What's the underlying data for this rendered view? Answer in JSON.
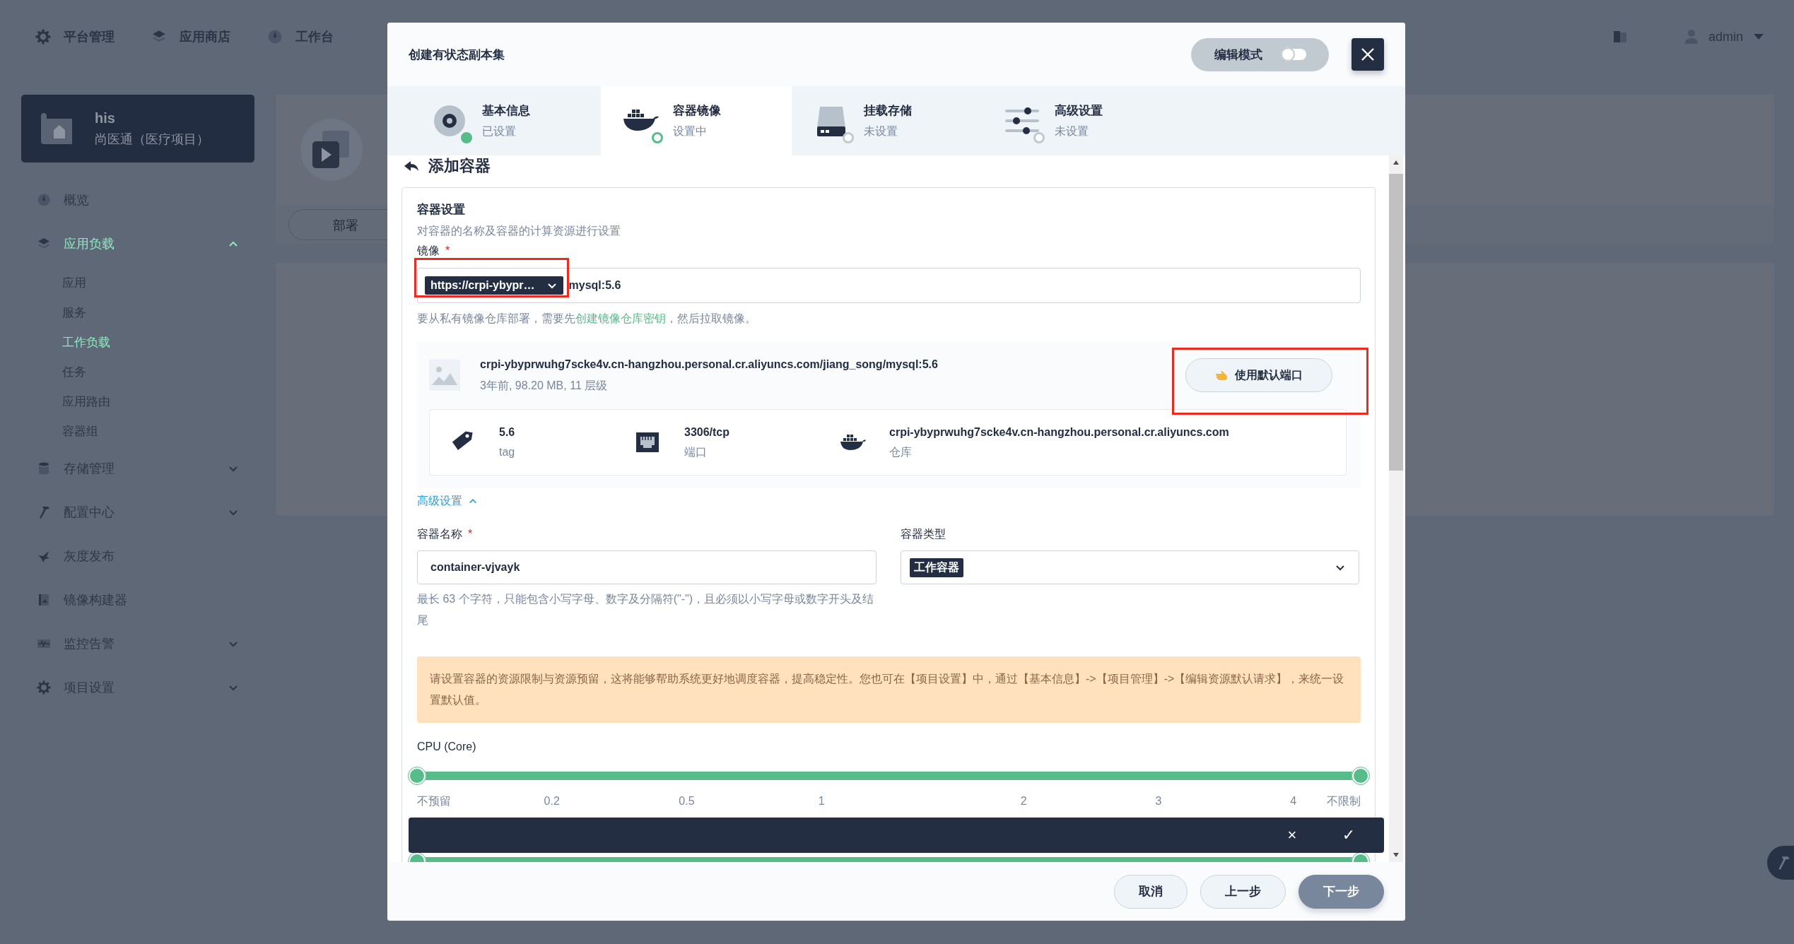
{
  "top_nav": {
    "items": [
      {
        "label": "平台管理"
      },
      {
        "label": "应用商店"
      },
      {
        "label": "工作台"
      }
    ],
    "user": "admin"
  },
  "sidebar": {
    "project": {
      "name": "his",
      "description": "尚医通（医疗项目）"
    },
    "items": [
      {
        "label": "概览",
        "selected": false
      },
      {
        "label": "应用负载",
        "selected": true,
        "expanded": true,
        "children": [
          {
            "label": "应用",
            "selected": false
          },
          {
            "label": "服务",
            "selected": false
          },
          {
            "label": "工作负载",
            "selected": true
          },
          {
            "label": "任务",
            "selected": false
          },
          {
            "label": "应用路由",
            "selected": false
          },
          {
            "label": "容器组",
            "selected": false
          }
        ]
      },
      {
        "label": "存储管理",
        "selected": false,
        "expanded": false
      },
      {
        "label": "配置中心",
        "selected": false,
        "expanded": false
      },
      {
        "label": "灰度发布",
        "selected": false
      },
      {
        "label": "镜像构建器",
        "selected": false
      },
      {
        "label": "监控告警",
        "selected": false,
        "expanded": false
      },
      {
        "label": "项目设置",
        "selected": false,
        "expanded": false
      }
    ]
  },
  "background_page": {
    "tab": "部署"
  },
  "modal": {
    "title": "创建有状态副本集",
    "edit_mode": {
      "label": "编辑模式",
      "on": false
    },
    "steps": [
      {
        "title": "基本信息",
        "status_text": "已设置",
        "done": true,
        "selected": false
      },
      {
        "title": "容器镜像",
        "status_text": "设置中",
        "done": false,
        "selected": true
      },
      {
        "title": "挂载存储",
        "status_text": "未设置",
        "done": false,
        "selected": false
      },
      {
        "title": "高级设置",
        "status_text": "未设置",
        "done": false,
        "selected": false
      }
    ],
    "section_title": "添加容器",
    "settings": {
      "title": "容器设置",
      "description": "对容器的名称及容器的计算资源进行设置",
      "image": {
        "label": "镜像",
        "required_mark": "*",
        "registry": "https://crpi-ybypr…",
        "value": "mysql:5.6",
        "highlighted": true
      },
      "hint": [
        {
          "kind": "text",
          "text": "要从私有镜像仓库部署，需要先"
        },
        {
          "kind": "link",
          "text": "创建镜像仓库密钥"
        },
        {
          "kind": "text",
          "text": "，然后拉取镜像。"
        }
      ],
      "image_info": {
        "name": "crpi-ybyprwuhg7scke4v.cn-hangzhou.personal.cr.aliyuncs.com/jiang_song/mysql:5.6",
        "meta": "3年前, 98.20 MB, 11 层级",
        "action": {
          "label": "使用默认端口",
          "highlighted": true
        },
        "details": [
          {
            "kind": "tag",
            "value": "5.6",
            "label": "tag"
          },
          {
            "kind": "port",
            "value": "3306/tcp",
            "label": "端口"
          },
          {
            "kind": "registry",
            "value": "crpi-ybyprwuhg7scke4v.cn-hangzhou.personal.cr.aliyuncs.com",
            "label": "仓库"
          }
        ]
      },
      "advanced": {
        "label": "高级设置",
        "expanded": true
      },
      "name_field": {
        "label": "容器名称",
        "required_mark": "*",
        "value": "container-vjvayk",
        "hint": "最长 63 个字符，只能包含小写字母、数字及分隔符(\"-\")，且必须以小写字母或数字开头及结尾"
      },
      "type_field": {
        "label": "容器类型",
        "value": "工作容器"
      },
      "warning": "请设置容器的资源限制与资源预留，这将能够帮助系统更好地调度容器，提高稳定性。您也可在【项目设置】中，通过【基本信息】->【项目管理】->【编辑资源默认请求】，来统一设置默认值。",
      "sliders": [
        {
          "label": "CPU (Core)",
          "level": 1,
          "ticks": [
            "不预留",
            "0.2",
            "0.5",
            "1",
            "2",
            "3",
            "4",
            "不限制"
          ]
        },
        {
          "level": 1
        }
      ]
    },
    "confirm_bar": {
      "cancel": "×",
      "confirm": "✓"
    },
    "buttons": [
      {
        "label": "取消",
        "kind": "secondary"
      },
      {
        "label": "上一步",
        "kind": "secondary"
      },
      {
        "label": "下一步",
        "kind": "primary"
      }
    ]
  }
}
